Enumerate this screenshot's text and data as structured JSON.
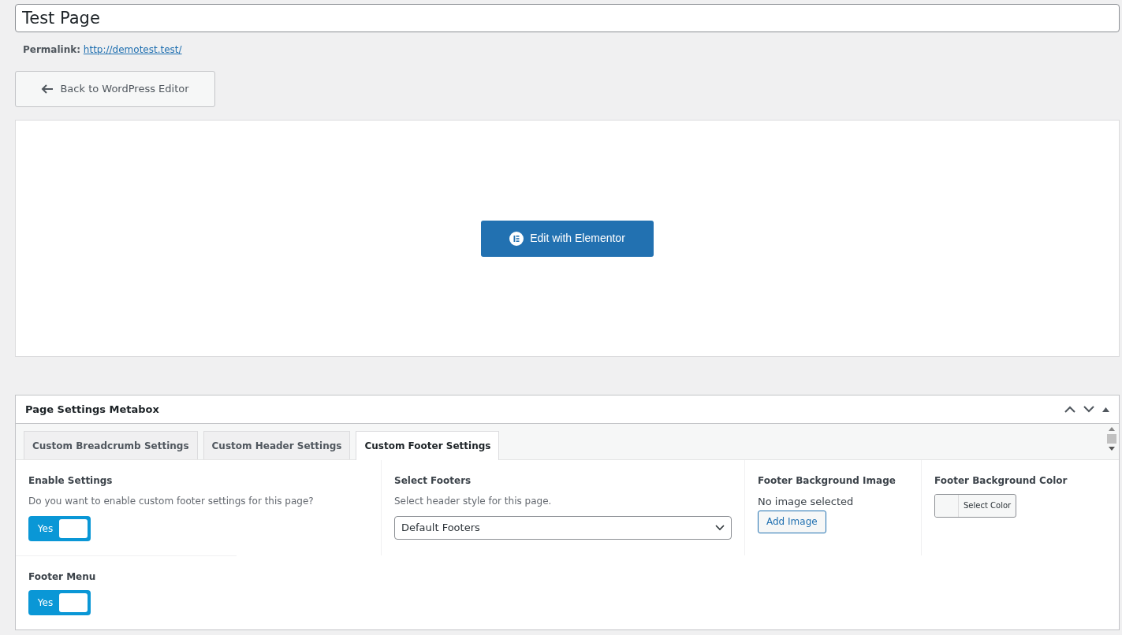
{
  "title_field": {
    "value": "Test Page"
  },
  "permalink": {
    "label": "Permalink:",
    "url": "http://demotest.test/"
  },
  "back_button": {
    "label": "Back to WordPress Editor"
  },
  "elementor_button": {
    "label": "Edit with Elementor"
  },
  "metabox": {
    "title": "Page Settings Metabox",
    "tabs": [
      {
        "label": "Custom Breadcrumb Settings",
        "selected": false
      },
      {
        "label": "Custom Header Settings",
        "selected": false
      },
      {
        "label": "Custom Footer Settings",
        "selected": true
      }
    ],
    "fields": [
      {
        "kind": "toggle",
        "label": "Enable Settings",
        "description": "Do you want to enable custom footer settings for this page?",
        "on": true,
        "toggle_label": "Yes"
      },
      {
        "kind": "select",
        "label": "Select Footers",
        "description": "Select header style for this page.",
        "value": "Default Footers"
      },
      {
        "kind": "image",
        "label": "Footer Background Image",
        "status": "No image selected",
        "button": "Add Image"
      },
      {
        "kind": "color",
        "label": "Footer Background Color",
        "button": "Select Color",
        "color": "#f6f7f7"
      },
      {
        "kind": "toggle",
        "label": "Footer Menu",
        "on": true,
        "toggle_label": "Yes"
      }
    ]
  }
}
